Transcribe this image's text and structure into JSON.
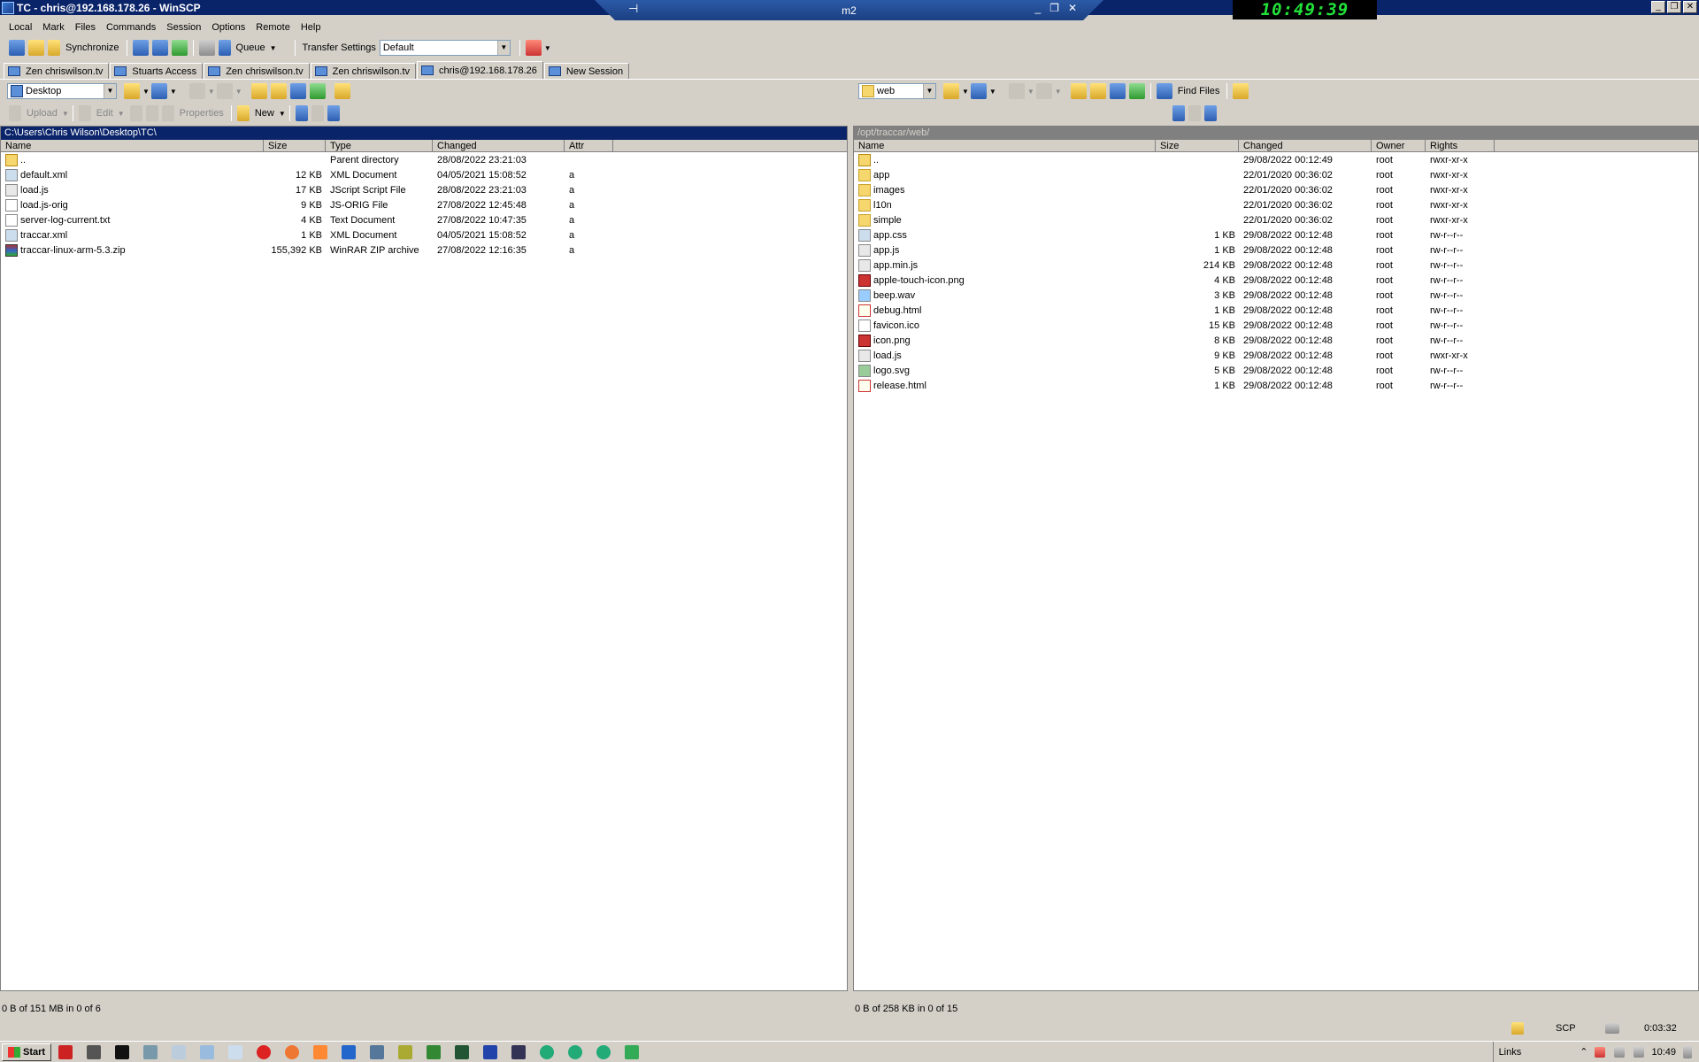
{
  "window": {
    "title": "TC - chris@192.168.178.26 - WinSCP",
    "remote_desktop_title": "m2",
    "clock": "10:49:39"
  },
  "menu": [
    "Local",
    "Mark",
    "Files",
    "Commands",
    "Session",
    "Options",
    "Remote",
    "Help"
  ],
  "toolbar": {
    "synchronize": "Synchronize",
    "queue": "Queue",
    "transfer_settings_label": "Transfer Settings",
    "transfer_settings_value": "Default"
  },
  "tabs": [
    {
      "label": "Zen chriswilson.tv",
      "active": false
    },
    {
      "label": "Stuarts Access",
      "active": false
    },
    {
      "label": "Zen chriswilson.tv",
      "active": false
    },
    {
      "label": "Zen chriswilson.tv",
      "active": false
    },
    {
      "label": "chris@192.168.178.26",
      "active": true
    },
    {
      "label": "New Session",
      "active": false
    }
  ],
  "local": {
    "location": "Desktop",
    "path": "C:\\Users\\Chris Wilson\\Desktop\\TC\\",
    "actions": {
      "upload": "Upload",
      "edit": "Edit",
      "properties": "Properties",
      "new": "New"
    },
    "columns": [
      "Name",
      "Size",
      "Type",
      "Changed",
      "Attr"
    ],
    "files": [
      {
        "name": "..",
        "size": "",
        "type": "Parent directory",
        "changed": "28/08/2022  23:21:03",
        "attr": "",
        "icon": "parent-dir-icon"
      },
      {
        "name": "default.xml",
        "size": "12 KB",
        "type": "XML Document",
        "changed": "04/05/2021  15:08:52",
        "attr": "a",
        "icon": "xml-file-icon"
      },
      {
        "name": "load.js",
        "size": "17 KB",
        "type": "JScript Script File",
        "changed": "28/08/2022  23:21:03",
        "attr": "a",
        "icon": "js-file-icon"
      },
      {
        "name": "load.js-orig",
        "size": "9 KB",
        "type": "JS-ORIG File",
        "changed": "27/08/2022  12:45:48",
        "attr": "a",
        "icon": "file-icon"
      },
      {
        "name": "server-log-current.txt",
        "size": "4 KB",
        "type": "Text Document",
        "changed": "27/08/2022  10:47:35",
        "attr": "a",
        "icon": "text-file-icon"
      },
      {
        "name": "traccar.xml",
        "size": "1 KB",
        "type": "XML Document",
        "changed": "04/05/2021  15:08:52",
        "attr": "a",
        "icon": "xml-file-icon"
      },
      {
        "name": "traccar-linux-arm-5.3.zip",
        "size": "155,392 KB",
        "type": "WinRAR ZIP archive",
        "changed": "27/08/2022  12:16:35",
        "attr": "a",
        "icon": "zip-file-icon"
      }
    ],
    "status": "0 B of 151 MB in 0 of 6"
  },
  "remote": {
    "location": "web",
    "path": "/opt/traccar/web/",
    "find_files": "Find Files",
    "columns": [
      "Name",
      "Size",
      "Changed",
      "Owner",
      "Rights"
    ],
    "files": [
      {
        "name": "..",
        "size": "",
        "changed": "29/08/2022 00:12:49",
        "owner": "root",
        "rights": "rwxr-xr-x",
        "icon": "parent-dir-icon"
      },
      {
        "name": "app",
        "size": "",
        "changed": "22/01/2020 00:36:02",
        "owner": "root",
        "rights": "rwxr-xr-x",
        "icon": "folder-icon"
      },
      {
        "name": "images",
        "size": "",
        "changed": "22/01/2020 00:36:02",
        "owner": "root",
        "rights": "rwxr-xr-x",
        "icon": "folder-icon"
      },
      {
        "name": "l10n",
        "size": "",
        "changed": "22/01/2020 00:36:02",
        "owner": "root",
        "rights": "rwxr-xr-x",
        "icon": "folder-icon"
      },
      {
        "name": "simple",
        "size": "",
        "changed": "22/01/2020 00:36:02",
        "owner": "root",
        "rights": "rwxr-xr-x",
        "icon": "folder-icon"
      },
      {
        "name": "app.css",
        "size": "1 KB",
        "changed": "29/08/2022 00:12:48",
        "owner": "root",
        "rights": "rw-r--r--",
        "icon": "css-file-icon"
      },
      {
        "name": "app.js",
        "size": "1 KB",
        "changed": "29/08/2022 00:12:48",
        "owner": "root",
        "rights": "rw-r--r--",
        "icon": "js-file-icon"
      },
      {
        "name": "app.min.js",
        "size": "214 KB",
        "changed": "29/08/2022 00:12:48",
        "owner": "root",
        "rights": "rw-r--r--",
        "icon": "js-file-icon"
      },
      {
        "name": "apple-touch-icon.png",
        "size": "4 KB",
        "changed": "29/08/2022 00:12:48",
        "owner": "root",
        "rights": "rw-r--r--",
        "icon": "png-file-icon"
      },
      {
        "name": "beep.wav",
        "size": "3 KB",
        "changed": "29/08/2022 00:12:48",
        "owner": "root",
        "rights": "rw-r--r--",
        "icon": "audio-file-icon"
      },
      {
        "name": "debug.html",
        "size": "1 KB",
        "changed": "29/08/2022 00:12:48",
        "owner": "root",
        "rights": "rw-r--r--",
        "icon": "html-file-icon"
      },
      {
        "name": "favicon.ico",
        "size": "15 KB",
        "changed": "29/08/2022 00:12:48",
        "owner": "root",
        "rights": "rw-r--r--",
        "icon": "file-icon"
      },
      {
        "name": "icon.png",
        "size": "8 KB",
        "changed": "29/08/2022 00:12:48",
        "owner": "root",
        "rights": "rw-r--r--",
        "icon": "png-file-icon"
      },
      {
        "name": "load.js",
        "size": "9 KB",
        "changed": "29/08/2022 00:12:48",
        "owner": "root",
        "rights": "rwxr-xr-x",
        "icon": "js-file-icon"
      },
      {
        "name": "logo.svg",
        "size": "5 KB",
        "changed": "29/08/2022 00:12:48",
        "owner": "root",
        "rights": "rw-r--r--",
        "icon": "svg-file-icon"
      },
      {
        "name": "release.html",
        "size": "1 KB",
        "changed": "29/08/2022 00:12:48",
        "owner": "root",
        "rights": "rw-r--r--",
        "icon": "html-file-icon"
      }
    ],
    "status": "0 B of 258 KB in 0 of 15"
  },
  "bottom": {
    "protocol": "SCP",
    "elapsed": "0:03:32"
  },
  "taskbar": {
    "start": "Start",
    "links": "Links",
    "time": "10:49"
  }
}
